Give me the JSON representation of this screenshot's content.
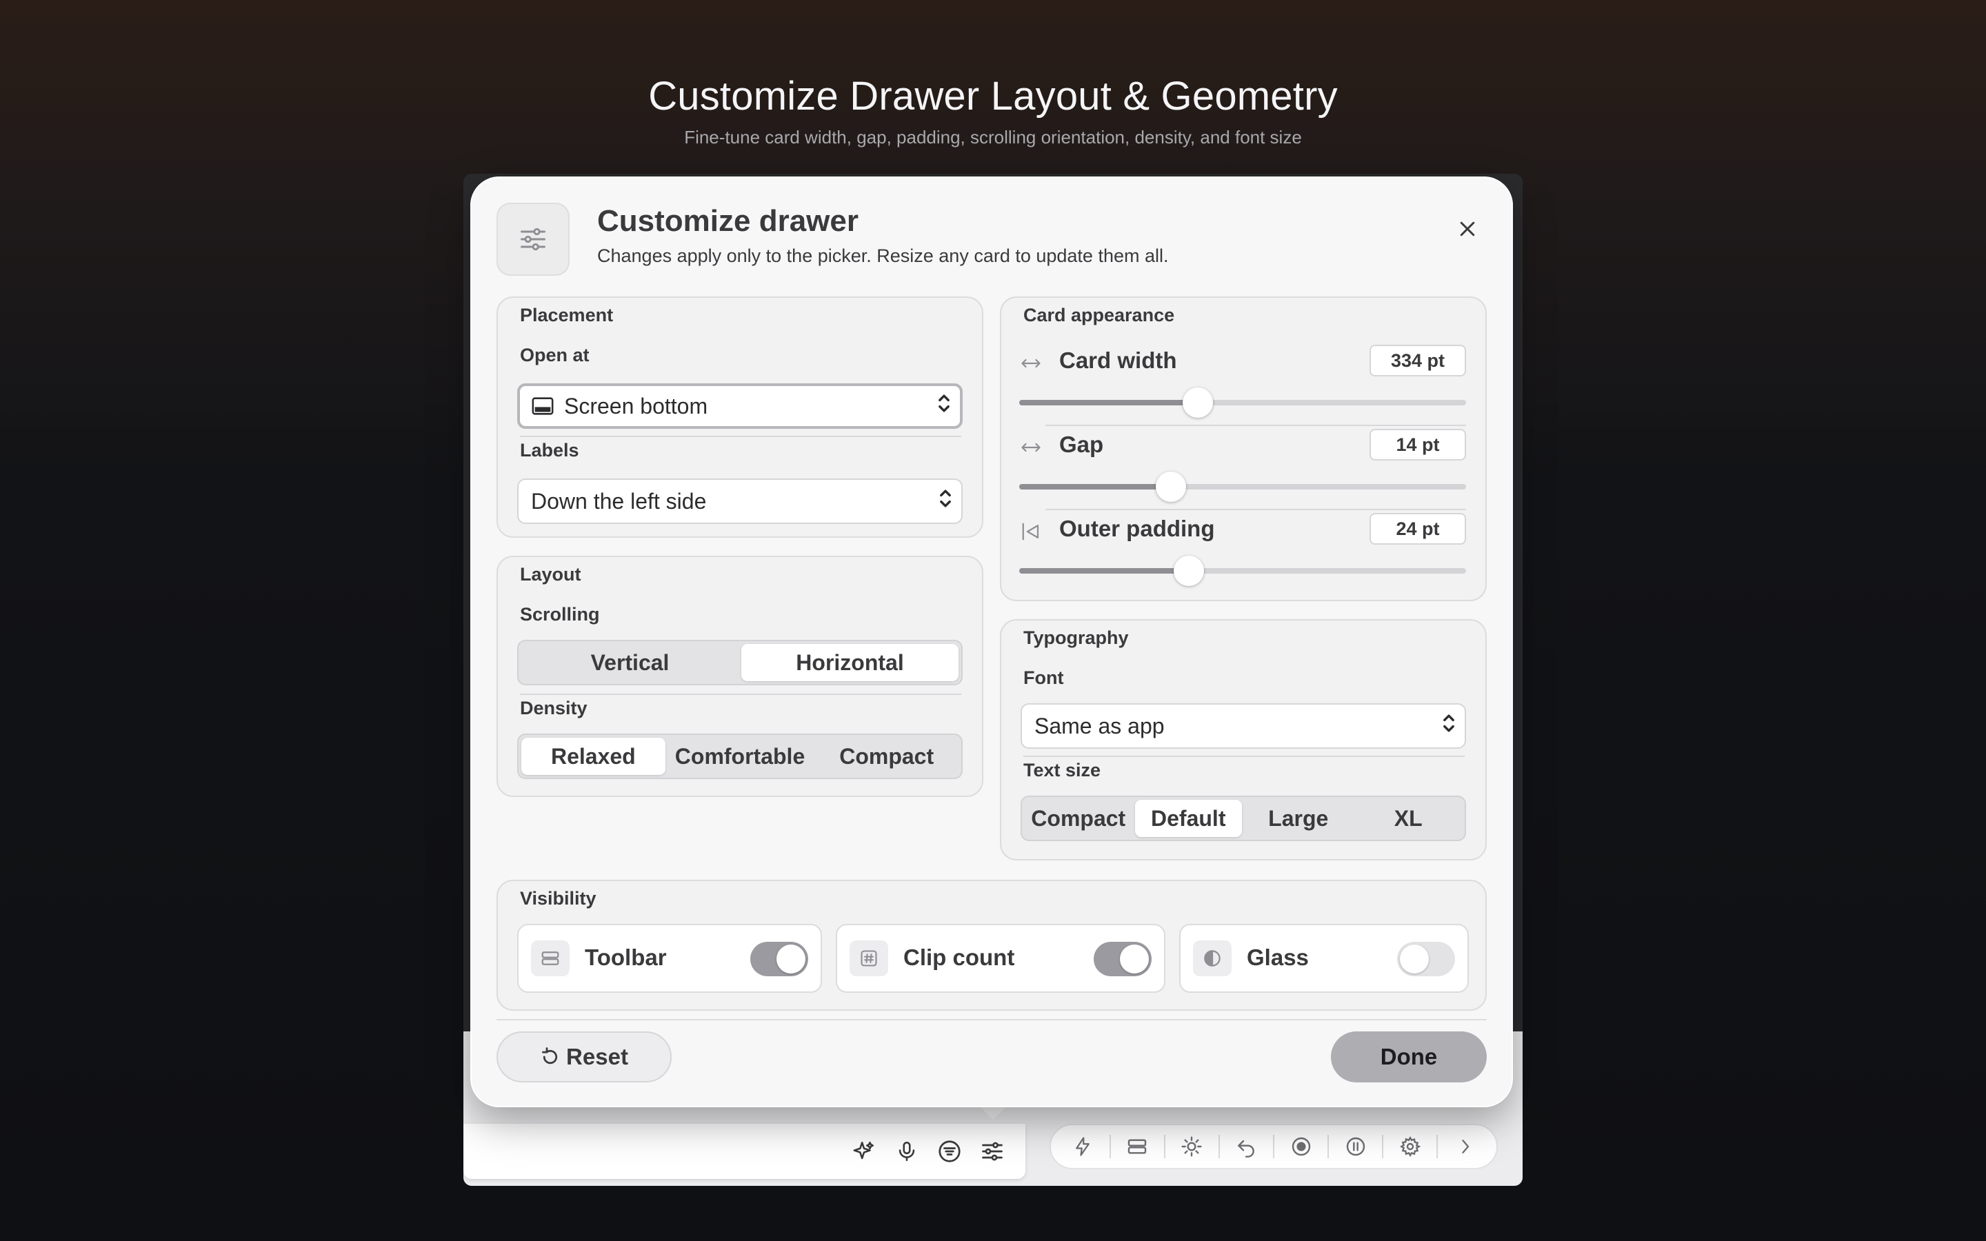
{
  "page": {
    "title": "Customize Drawer Layout & Geometry",
    "subtitle": "Fine-tune card width, gap, padding, scrolling orientation, density, and font size"
  },
  "dialog": {
    "title": "Customize drawer",
    "subtitle": "Changes apply only to the picker. Resize any card to update them all.",
    "header_icon": "sliders-icon",
    "close_icon": "close-icon"
  },
  "placement": {
    "title": "Placement",
    "open_at_label": "Open at",
    "open_at_value": "Screen bottom",
    "labels_label": "Labels",
    "labels_value": "Down the left side"
  },
  "layout": {
    "title": "Layout",
    "scrolling_label": "Scrolling",
    "scrolling_options": [
      "Vertical",
      "Horizontal"
    ],
    "scrolling_selected": "Horizontal",
    "density_label": "Density",
    "density_options": [
      "Relaxed",
      "Comfortable",
      "Compact"
    ],
    "density_selected": "Relaxed"
  },
  "card_appearance": {
    "title": "Card appearance",
    "rows": [
      {
        "label": "Card width",
        "value": "334 pt",
        "icon": "horizontal-arrows-icon",
        "level": 0.4
      },
      {
        "label": "Gap",
        "value": "14 pt",
        "icon": "horizontal-arrows-icon",
        "level": 0.34
      },
      {
        "label": "Outer padding",
        "value": "24 pt",
        "icon": "padding-icon",
        "level": 0.38
      }
    ]
  },
  "typography": {
    "title": "Typography",
    "font_label": "Font",
    "font_value": "Same as app",
    "text_size_label": "Text size",
    "text_size_options": [
      "Compact",
      "Default",
      "Large",
      "XL"
    ],
    "text_size_selected": "Default"
  },
  "visibility": {
    "title": "Visibility",
    "items": [
      {
        "label": "Toolbar",
        "on": true,
        "icon": "toolbar-icon"
      },
      {
        "label": "Clip count",
        "on": true,
        "icon": "hash-icon"
      },
      {
        "label": "Glass",
        "on": false,
        "icon": "half-circle-icon"
      }
    ]
  },
  "footer": {
    "reset_label": "Reset",
    "done_label": "Done"
  },
  "bottom_bar": {
    "left_icons": [
      "sparkles-icon",
      "microphone-icon",
      "filter-icon",
      "sliders-icon"
    ],
    "right_icons": [
      "bolt-icon",
      "stack-icon",
      "sun-icon",
      "undo-icon",
      "record-icon",
      "pause-icon",
      "gear-icon",
      "chevron-right-icon"
    ]
  },
  "colors": {
    "dialog_bg": "#f7f7f8",
    "toggle_on": "#9a9aa0",
    "done_button": "#aeaeb2"
  }
}
